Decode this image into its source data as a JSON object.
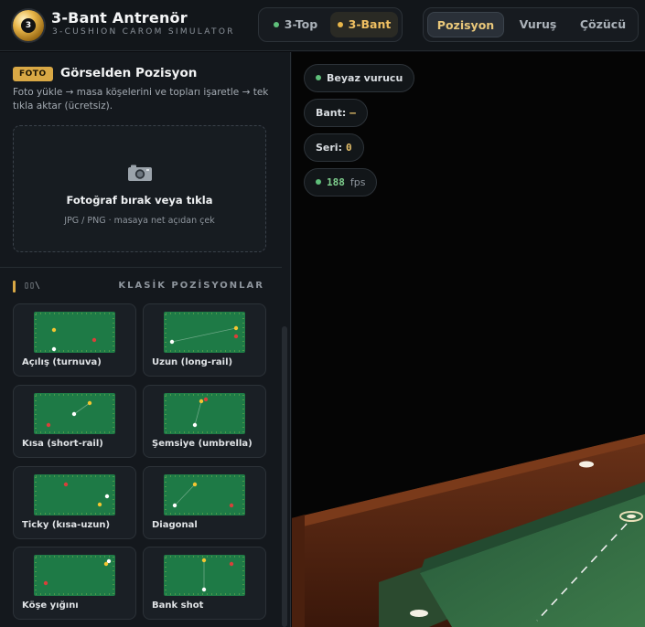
{
  "header": {
    "title": "3-Bant Antrenör",
    "subtitle": "3-CUSHION CAROM SIMULATOR",
    "logo_number": "3",
    "mode_toggle": [
      {
        "label": "3-Top",
        "active": false,
        "dot_color": "#5fbf7a"
      },
      {
        "label": "3-Bant",
        "active": true,
        "dot_color": "#e8b64a"
      }
    ],
    "tabs": [
      {
        "label": "Pozisyon",
        "active": true
      },
      {
        "label": "Vuruş",
        "active": false
      },
      {
        "label": "Çözücü",
        "active": false
      }
    ]
  },
  "sidebar": {
    "photo_section": {
      "badge": "FOTO",
      "title": "Görselden Pozisyon",
      "description": "Foto yükle → masa köşelerini ve topları işaretle → tek tıkla aktar (ücretsiz).",
      "drop_title": "Fotoğraf bırak veya tıkla",
      "drop_hint": "JPG / PNG · masaya net açıdan çek",
      "icon": "camera-icon"
    },
    "classic_section": {
      "icon_text": "▯▯\\",
      "title": "KLASİK POZİSYONLAR",
      "positions": [
        {
          "label": "Açılış (turnuva)"
        },
        {
          "label": "Uzun (long-rail)"
        },
        {
          "label": "Kısa (short-rail)"
        },
        {
          "label": "Şemsiye (umbrella)"
        },
        {
          "label": "Ticky (kısa-uzun)"
        },
        {
          "label": "Diagonal"
        },
        {
          "label": "Köşe yığını"
        },
        {
          "label": "Bank shot"
        }
      ]
    }
  },
  "hud": {
    "striker": "Beyaz vurucu",
    "striker_dot_color": "#5fbf7a",
    "bant_label": "Bant:",
    "bant_value": "–",
    "seri_label": "Seri:",
    "seri_value": "0",
    "fps_value": "188",
    "fps_unit": "fps"
  },
  "colors": {
    "accent_gold": "#d9a845",
    "felt_green": "#1f7a46",
    "rail_wood": "#5a2a16"
  }
}
